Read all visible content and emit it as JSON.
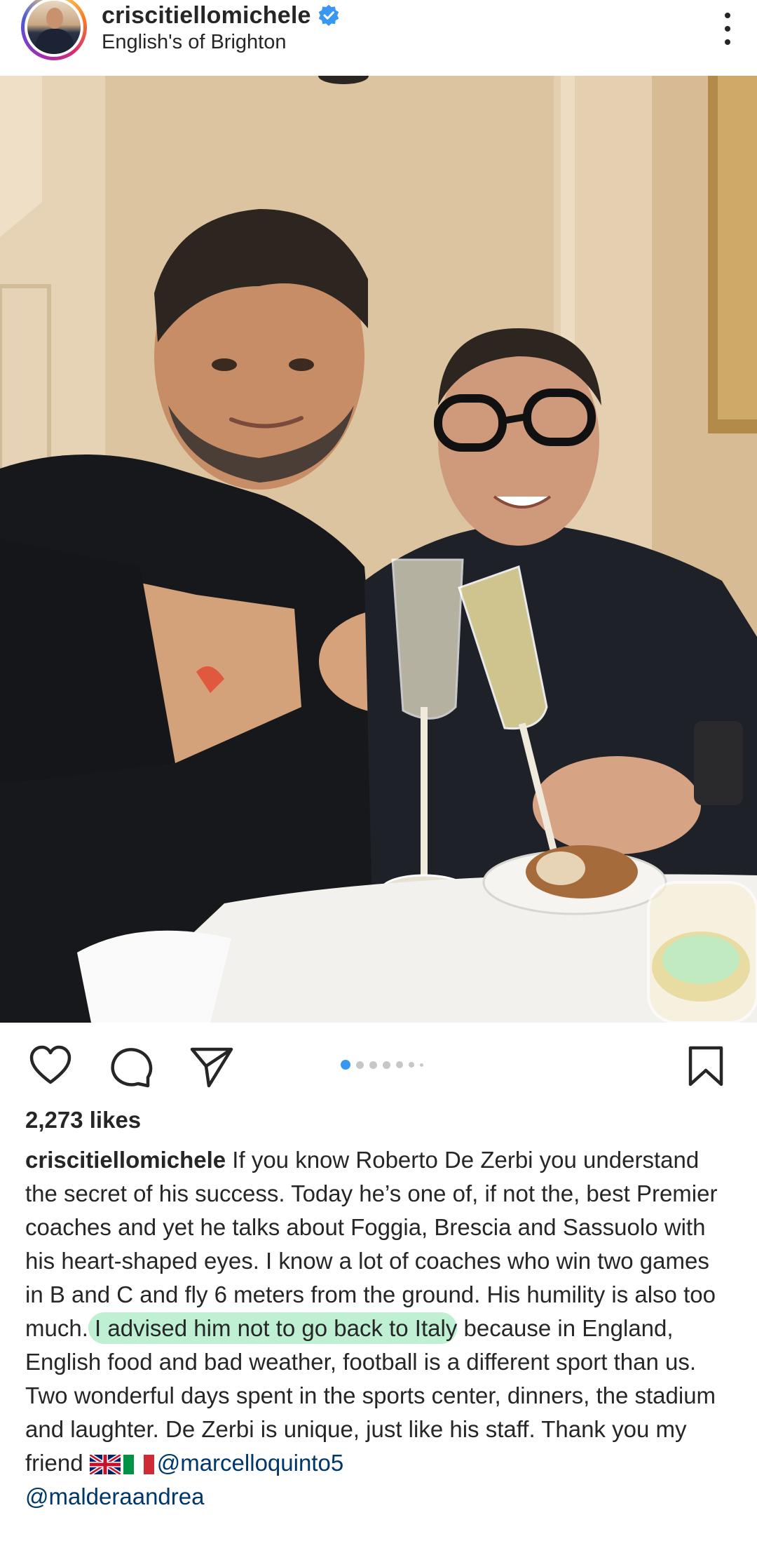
{
  "header": {
    "username": "criscitiellomichele",
    "location": "English's of Brighton"
  },
  "pagination": {
    "current": 1,
    "total": 7
  },
  "likes": "2,273 likes",
  "caption": {
    "author": "criscitiellomichele",
    "text_before": " If you know Roberto De Zerbi you understand the secret of his success. Today he’s one of, if not the, best Premier coaches and yet he talks about Foggia, Brescia and Sassuolo with his heart-shaped eyes. I know a lot of coaches who win two games in B and C and fly 6 meters from the ground. His humility is also too much.",
    "highlight": " I advised him not to go back to Italy",
    "text_after": " because in England, English food and bad weather, football is a different sport than us. Two wonderful days spent in the sports center, dinners, the stadium and laughter. De Zerbi is unique, just like his staff. Thank you my friend ",
    "mention1": "@marcelloquinto5",
    "mention2": "@malderaandrea"
  },
  "icons": {
    "verified": "verified-badge-icon",
    "more": "more-options-icon",
    "like": "heart-icon",
    "comment": "comment-bubble-icon",
    "share": "paper-plane-icon",
    "save": "bookmark-icon",
    "flags": [
      "uk-flag",
      "italy-flag"
    ]
  },
  "colors": {
    "verified": "#3897f0",
    "active_dot": "#3897f0",
    "highlight": "#bff0d4",
    "mention": "#00376b"
  }
}
